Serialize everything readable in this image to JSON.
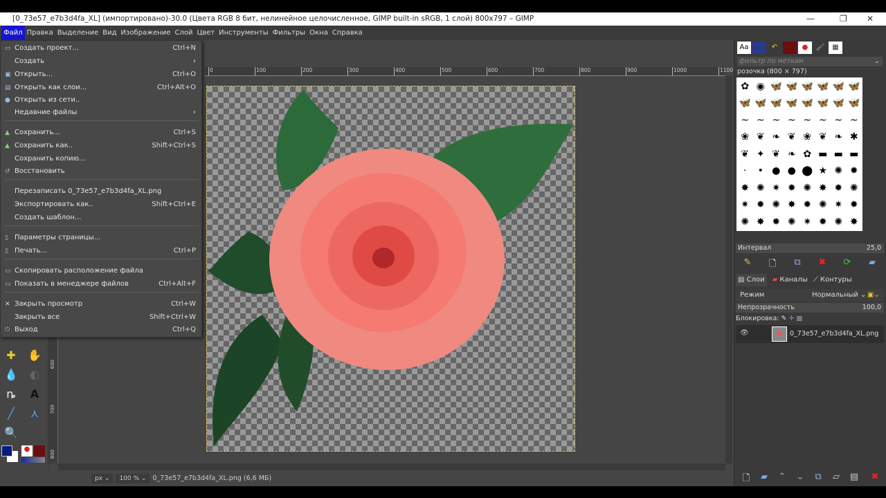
{
  "window": {
    "title": "[0_73e57_e7b3d4fa_XL] (импортировано)-30.0 (Цвета RGB 8 бит, нелинейное целочисленное, GIMP built-in sRGB, 1 слой) 800x797 – GIMP"
  },
  "menubar": [
    "Файл",
    "Правка",
    "Выделение",
    "Вид",
    "Изображение",
    "Слой",
    "Цвет",
    "Инструменты",
    "Фильтры",
    "Окна",
    "Справка"
  ],
  "file_menu": [
    {
      "label": "Создать проект...",
      "shortcut": "Ctrl+N",
      "icon": "new-icon"
    },
    {
      "label": "Создать",
      "shortcut": "›",
      "icon": ""
    },
    {
      "label": "Открыть...",
      "shortcut": "Ctrl+O",
      "icon": "open-icon"
    },
    {
      "label": "Открыть как слои...",
      "shortcut": "Ctrl+Alt+O",
      "icon": "open-layers-icon"
    },
    {
      "label": "Открыть из сети..",
      "shortcut": "",
      "icon": "globe-icon"
    },
    {
      "label": "Недавние файлы",
      "shortcut": "›",
      "icon": ""
    },
    {
      "label": "Сохранить...",
      "shortcut": "Ctrl+S",
      "icon": "save-icon"
    },
    {
      "label": "Сохранить как..",
      "shortcut": "Shift+Ctrl+S",
      "icon": "save-as-icon"
    },
    {
      "label": "Сохранить копию...",
      "shortcut": "",
      "icon": ""
    },
    {
      "label": "Восстановить",
      "shortcut": "",
      "icon": "revert-icon"
    },
    {
      "label": "Перезаписать 0_73e57_e7b3d4fa_XL.png",
      "shortcut": "",
      "icon": ""
    },
    {
      "label": "Экспортировать как..",
      "shortcut": "Shift+Ctrl+E",
      "icon": ""
    },
    {
      "label": "Создать шаблон...",
      "shortcut": "",
      "icon": ""
    },
    {
      "label": "Параметры страницы...",
      "shortcut": "",
      "icon": "page-setup-icon"
    },
    {
      "label": "Печать...",
      "shortcut": "Ctrl+P",
      "icon": "print-icon"
    },
    {
      "label": "Скопировать расположение файла",
      "shortcut": "",
      "icon": "copy-icon"
    },
    {
      "label": "Показать в менеджере файлов",
      "shortcut": "Ctrl+Alt+F",
      "icon": "folder-icon"
    },
    {
      "label": "Закрыть просмотр",
      "shortcut": "Ctrl+W",
      "icon": "close-icon"
    },
    {
      "label": "Закрыть все",
      "shortcut": "Shift+Ctrl+W",
      "icon": ""
    },
    {
      "label": "Выход",
      "shortcut": "Ctrl+Q",
      "icon": "quit-icon"
    }
  ],
  "ruler": [
    "0",
    "100",
    "200",
    "300",
    "400",
    "500",
    "600",
    "700",
    "800",
    "900",
    "1000",
    "1100"
  ],
  "vruler": [
    "600",
    "700",
    "800"
  ],
  "status": {
    "unit": "px",
    "zoom": "100 %",
    "file": "0_73e57_e7b3d4fa_XL.png (6,6 МБ)"
  },
  "brushes": {
    "filter_placeholder": "фильтр по меткам",
    "current": "розочка (800 × 797)",
    "interval_label": "Интервал",
    "interval": "25,0"
  },
  "layers": {
    "tabs": [
      "Слои",
      "Каналы",
      "Контуры"
    ],
    "mode_label": "Режим",
    "mode": "Нормальный",
    "opacity_label": "Непрозрачность",
    "opacity": "100,0",
    "lock_label": "Блокировка:",
    "layer_name": "0_73e57_e7b3d4fa_XL.png"
  },
  "colors": {
    "fg": "#0a1a80",
    "bg": "#ffffff",
    "accent": "#1515d0"
  }
}
